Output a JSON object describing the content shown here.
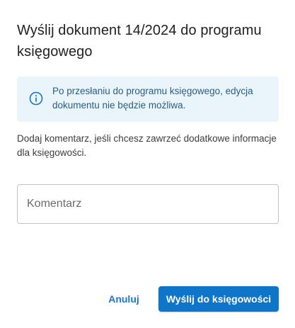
{
  "dialog": {
    "title": "Wyślij dokument 14/2024 do programu księgowego",
    "info": {
      "icon": "info-circle-icon",
      "text": "Po przesłaniu do programu księgowego, edycja dokumentu nie będzie możliwa."
    },
    "description": "Dodaj komentarz, jeśli chcesz zawrzeć dodatkowe informacje dla księgowości.",
    "comment": {
      "placeholder": "Komentarz",
      "value": ""
    },
    "actions": {
      "cancel_label": "Anuluj",
      "submit_label": "Wyślij do księgowości"
    }
  },
  "colors": {
    "accent": "#0f75c8",
    "info_background": "#eaf4fb",
    "info_text": "#2b5d80",
    "link": "#1976d2"
  }
}
